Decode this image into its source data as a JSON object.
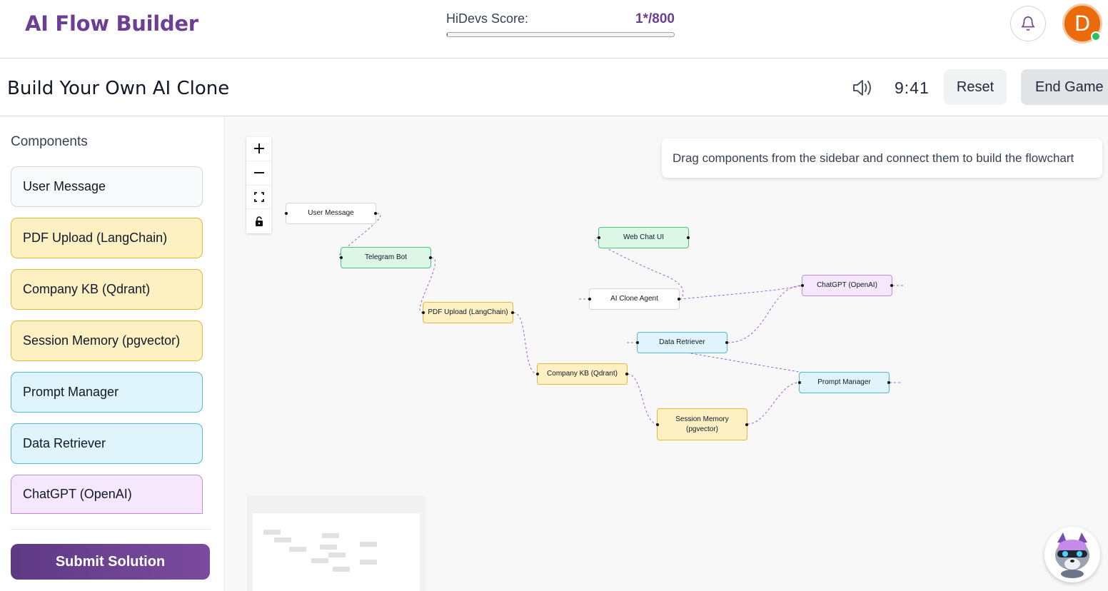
{
  "header": {
    "brand": "AI Flow Builder",
    "score_label": "HiDevs Score:",
    "score_value": "1*/800",
    "score_progress": 0.00125,
    "avatar_initial": "D",
    "accent_color": "#6b3f94",
    "avatar_color": "#ea6b0c"
  },
  "subheader": {
    "title": "Build Your Own AI Clone",
    "timer": "9:41",
    "reset_label": "Reset",
    "end_label": "End Game"
  },
  "sidebar": {
    "title": "Components",
    "items": [
      {
        "label": "User Message",
        "color": "gray"
      },
      {
        "label": "PDF Upload (LangChain)",
        "color": "yellow"
      },
      {
        "label": "Company KB (Qdrant)",
        "color": "yellow"
      },
      {
        "label": "Session Memory (pgvector)",
        "color": "yellow"
      },
      {
        "label": "Prompt Manager",
        "color": "blue"
      },
      {
        "label": "Data Retriever",
        "color": "blue"
      },
      {
        "label": "ChatGPT (OpenAI)",
        "color": "purple"
      }
    ],
    "submit_label": "Submit Solution"
  },
  "canvas": {
    "hint": "Drag components from the sidebar and connect them to build the flowchart",
    "nodes": {
      "user_message": "User Message",
      "telegram_bot": "Telegram Bot",
      "pdf_upload": "PDF Upload (LangChain)",
      "web_chat_ui": "Web Chat UI",
      "ai_clone_agent": "AI Clone Agent",
      "chatgpt": "ChatGPT (OpenAI)",
      "data_retriever": "Data Retriever",
      "company_kb": "Company KB (Qdrant)",
      "session_memory_line1": "Session Memory",
      "session_memory_line2": "(pgvector)",
      "prompt_manager": "Prompt Manager"
    },
    "edge_color": "#9b5fd6"
  }
}
